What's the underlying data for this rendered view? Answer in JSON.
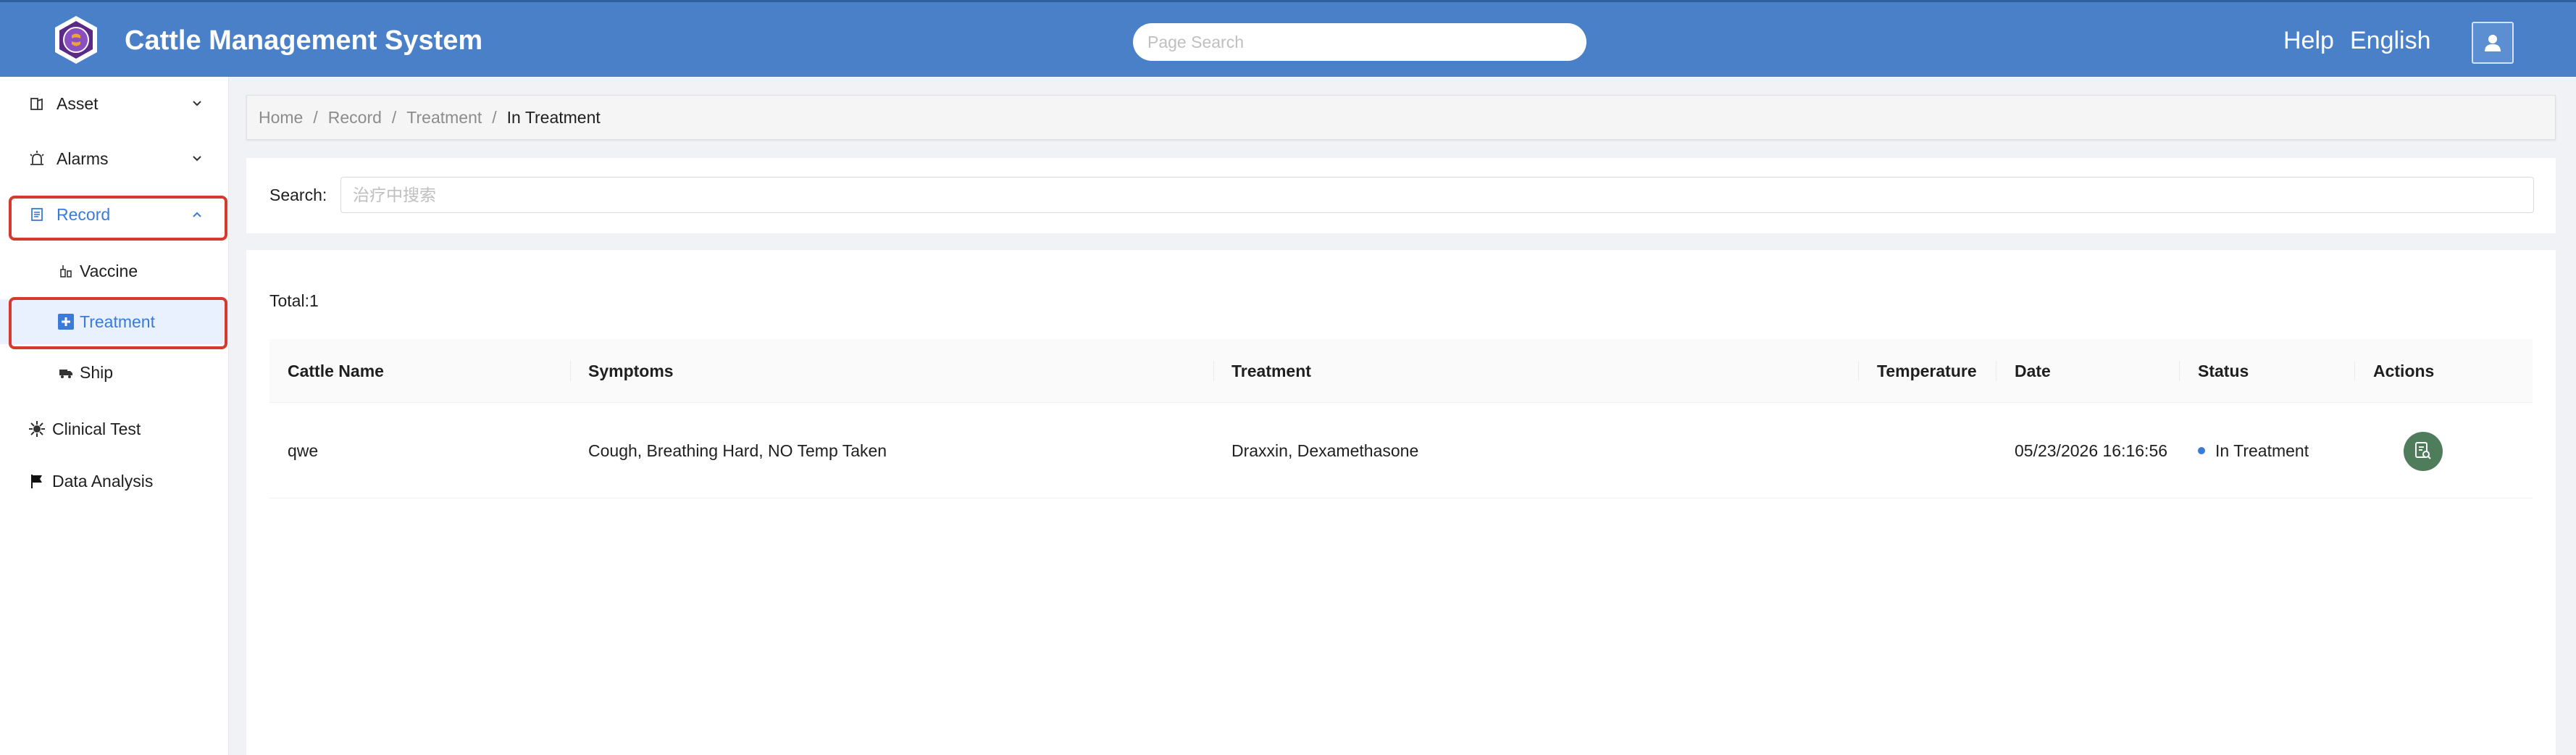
{
  "header": {
    "app_title": "Cattle Management System",
    "search_placeholder": "Page Search",
    "help": "Help",
    "language": "English"
  },
  "sidebar": {
    "items": [
      {
        "label": "Asset",
        "icon": "asset-icon"
      },
      {
        "label": "Alarms",
        "icon": "alarm-icon"
      },
      {
        "label": "Record",
        "icon": "record-icon"
      },
      {
        "label": "Clinical Test",
        "icon": "clinical-test-icon"
      },
      {
        "label": "Data Analysis",
        "icon": "flag-icon"
      }
    ],
    "record_children": [
      {
        "label": "Vaccine",
        "icon": "vaccine-icon"
      },
      {
        "label": "Treatment",
        "icon": "plus-square-icon"
      },
      {
        "label": "Ship",
        "icon": "truck-icon"
      }
    ]
  },
  "breadcrumb": [
    "Home",
    "Record",
    "Treatment",
    "In Treatment"
  ],
  "search": {
    "label": "Search:",
    "placeholder": "治疗中搜索"
  },
  "table": {
    "total": "Total:1",
    "columns": [
      "Cattle Name",
      "Symptoms",
      "Treatment",
      "Temperature",
      "Date",
      "Status",
      "Actions"
    ],
    "rows": [
      {
        "cattle_name": "qwe",
        "symptoms": "Cough, Breathing Hard, NO Temp Taken",
        "treatment": "Draxxin, Dexamethasone",
        "temperature": "",
        "date": "05/23/2026 16:16:56",
        "status": "In Treatment"
      }
    ]
  },
  "colors": {
    "header_bg": "#4a80c8",
    "accent": "#3a7ad9",
    "highlight_border": "#d63a2e",
    "action_button": "#4f7d5c"
  }
}
